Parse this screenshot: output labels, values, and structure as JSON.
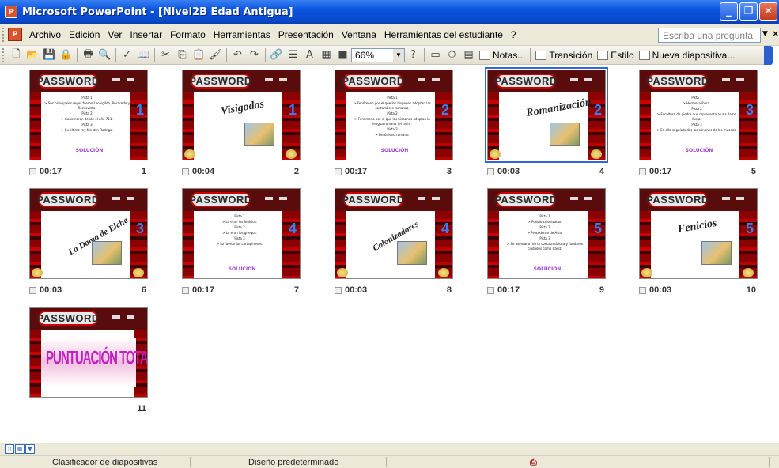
{
  "window": {
    "title": "Microsoft PowerPoint - [Nivel2B Edad Antigua]",
    "controls": {
      "minimize": "_",
      "maximize": "❐",
      "close": "✕"
    }
  },
  "menubar": {
    "items": [
      "Archivo",
      "Edición",
      "Ver",
      "Insertar",
      "Formato",
      "Herramientas",
      "Presentación",
      "Ventana",
      "Herramientas del estudiante",
      "?"
    ],
    "ask_placeholder": "Escriba una pregunta"
  },
  "toolbar": {
    "zoom": "66%",
    "notes_label": "Notas...",
    "transition_label": "Transición",
    "style_label": "Estilo",
    "new_slide_label": "Nueva diapositiva..."
  },
  "slides": [
    {
      "index": "1",
      "time": "00:17",
      "kind": "text",
      "badge": "1",
      "lines": [
        "Pista 1",
        "> Sus principales reyes fueron Leovigildo, Recaredo y Recesvinto.",
        "Pista 2",
        "> Gobernaron desde el año 711.",
        "Pista 3",
        "> Su último rey fue don Rodrigo."
      ],
      "solution": "SOLUCIÓN"
    },
    {
      "index": "2",
      "time": "00:04",
      "kind": "answer",
      "badge": "1",
      "word": "Visigodos"
    },
    {
      "index": "3",
      "time": "00:17",
      "kind": "text",
      "badge": "2",
      "lines": [
        "Pista 1",
        "> Fenómeno por el que los hispanos adoptan las costumbres romanas.",
        "Pista 2",
        "> Fenómeno por el que los hispanos adoptan la lengua romana (el latín).",
        "Pista 3",
        "> Fenómeno romano."
      ],
      "solution": "SOLUCIÓN"
    },
    {
      "index": "4",
      "time": "00:03",
      "kind": "answer",
      "badge": "2",
      "word": "Romanización",
      "selected": true
    },
    {
      "index": "5",
      "time": "00:17",
      "kind": "text",
      "badge": "3",
      "lines": [
        "Pista 1",
        "> Hermosa íbera.",
        "Pista 2",
        "> Escultura de piedra que representa a una dama íbera.",
        "Pista 3",
        "> En ella seguía todas las cánones de los museos."
      ],
      "solution": "SOLUCIÓN"
    },
    {
      "index": "6",
      "time": "00:03",
      "kind": "answer",
      "badge": "3",
      "word": "La Dama de Elche"
    },
    {
      "index": "7",
      "time": "00:17",
      "kind": "text",
      "badge": "4",
      "lines": [
        "Pista 1",
        "> Lo eran los fenicios.",
        "Pista 2",
        "> Lo eran los griegos.",
        "Pista 3",
        "> Lo fueron los cartagineses."
      ],
      "solution": "SOLUCIÓN"
    },
    {
      "index": "8",
      "time": "00:03",
      "kind": "answer",
      "badge": "4",
      "word": "Colonizadores"
    },
    {
      "index": "9",
      "time": "00:17",
      "kind": "text",
      "badge": "5",
      "lines": [
        "Pista 1",
        "> Pueblo colonizador.",
        "Pista 2",
        "> Procedente de Asia.",
        "Pista 3",
        "> Se asentaron en la costa andaluza y fundaron ciudades como Cádiz."
      ],
      "solution": "SOLUCIÓN"
    },
    {
      "index": "10",
      "time": "00:03",
      "kind": "answer",
      "badge": "5",
      "word": "Fenicios"
    },
    {
      "index": "11",
      "time": "",
      "kind": "final",
      "badge": "",
      "word": "PUNTUACIÓN TOTAL"
    }
  ],
  "slide_brand": "PASSWORD",
  "statusbar": {
    "view": "Clasificador de diapositivas",
    "design": "Diseño predeterminado"
  },
  "colors": {
    "titlebar": "#0a55e0",
    "accent_blue": "#3a80f3",
    "brand_red": "#c00000",
    "solution": "#a040d0"
  }
}
